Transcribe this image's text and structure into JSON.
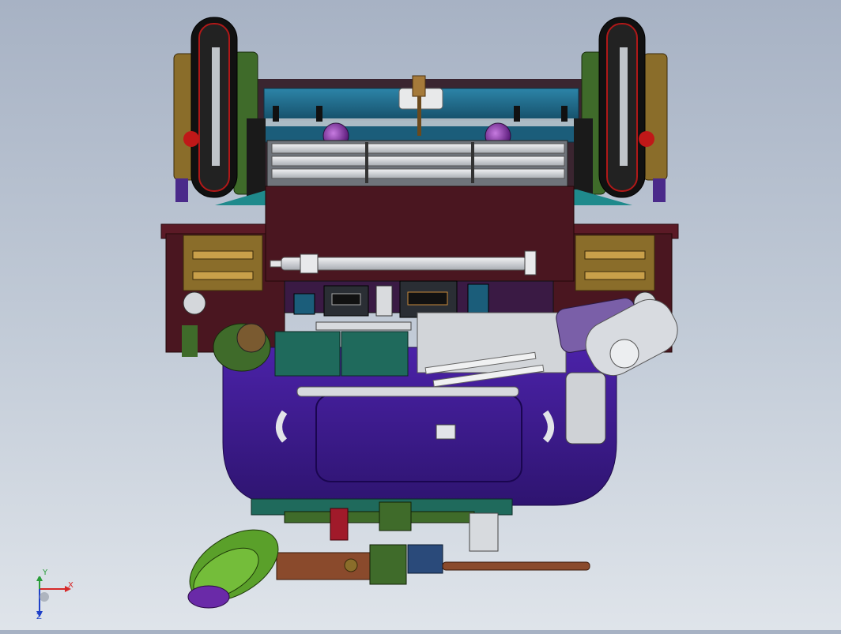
{
  "viewport": {
    "background_top": "#a7b2c4",
    "background_bottom": "#dfe4ea"
  },
  "axis_triad": {
    "x_label": "X",
    "y_label": "Y",
    "z_label": "Z",
    "x_color": "#d62828",
    "y_color": "#2a9d3a",
    "z_color": "#1e40c8"
  },
  "model_colors": {
    "frame_maroon": "#4a1620",
    "hull_purple": "#3d1a8c",
    "teal_housing": "#1f6e8c",
    "grille_silver": "#d9dde2",
    "wheel_tire": "#111111",
    "wheel_rim": "#c0c4c9",
    "bracket_olive": "#8a6d2a",
    "bracket_green": "#3f6b2a",
    "gun_rust": "#8a4a2c",
    "turret_green": "#5aa02a"
  }
}
